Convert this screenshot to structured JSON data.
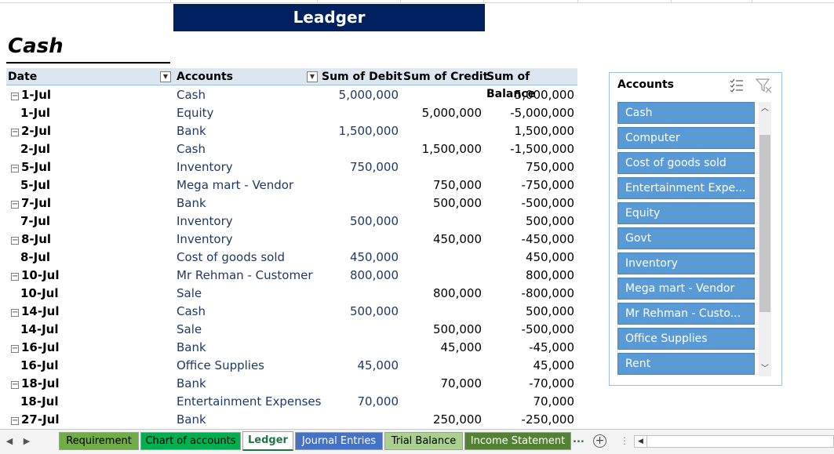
{
  "banner": "Leadger",
  "cash_title": "Cash",
  "pivot": {
    "headers": {
      "date": "Date",
      "accounts": "Accounts",
      "debit": "Sum of Debit",
      "credit": "Sum of Credit",
      "balance": "Sum of Balance"
    },
    "rows": [
      {
        "date": "1-Jul",
        "group": true,
        "account": "Cash",
        "debit": "5,000,000",
        "credit": "",
        "balance": "5,000,000"
      },
      {
        "date": "1-Jul",
        "group": false,
        "account": "Equity",
        "debit": "",
        "credit": "5,000,000",
        "balance": "-5,000,000"
      },
      {
        "date": "2-Jul",
        "group": true,
        "account": "Bank",
        "debit": "1,500,000",
        "credit": "",
        "balance": "1,500,000"
      },
      {
        "date": "2-Jul",
        "group": false,
        "account": "Cash",
        "debit": "",
        "credit": "1,500,000",
        "balance": "-1,500,000"
      },
      {
        "date": "5-Jul",
        "group": true,
        "account": "Inventory",
        "debit": "750,000",
        "credit": "",
        "balance": "750,000"
      },
      {
        "date": "5-Jul",
        "group": false,
        "account": "Mega mart - Vendor",
        "debit": "",
        "credit": "750,000",
        "balance": "-750,000"
      },
      {
        "date": "7-Jul",
        "group": true,
        "account": "Bank",
        "debit": "",
        "credit": "500,000",
        "balance": "-500,000"
      },
      {
        "date": "7-Jul",
        "group": false,
        "account": "Inventory",
        "debit": "500,000",
        "credit": "",
        "balance": "500,000"
      },
      {
        "date": "8-Jul",
        "group": true,
        "account": "Inventory",
        "debit": "",
        "credit": "450,000",
        "balance": "-450,000"
      },
      {
        "date": "8-Jul",
        "group": false,
        "account": "Cost of goods sold",
        "debit": "450,000",
        "credit": "",
        "balance": "450,000"
      },
      {
        "date": "10-Jul",
        "group": true,
        "account": "Mr Rehman - Customer",
        "debit": "800,000",
        "credit": "",
        "balance": "800,000"
      },
      {
        "date": "10-Jul",
        "group": false,
        "account": "Sale",
        "debit": "",
        "credit": "800,000",
        "balance": "-800,000"
      },
      {
        "date": "14-Jul",
        "group": true,
        "account": "Cash",
        "debit": "500,000",
        "credit": "",
        "balance": "500,000"
      },
      {
        "date": "14-Jul",
        "group": false,
        "account": "Sale",
        "debit": "",
        "credit": "500,000",
        "balance": "-500,000"
      },
      {
        "date": "16-Jul",
        "group": true,
        "account": "Bank",
        "debit": "",
        "credit": "45,000",
        "balance": "-45,000"
      },
      {
        "date": "16-Jul",
        "group": false,
        "account": "Office Supplies",
        "debit": "45,000",
        "credit": "",
        "balance": "45,000"
      },
      {
        "date": "18-Jul",
        "group": true,
        "account": "Bank",
        "debit": "",
        "credit": "70,000",
        "balance": "-70,000"
      },
      {
        "date": "18-Jul",
        "group": false,
        "account": "Entertainment Expenses",
        "debit": "70,000",
        "credit": "",
        "balance": "70,000"
      },
      {
        "date": "27-Jul",
        "group": true,
        "account": "Bank",
        "debit": "",
        "credit": "250,000",
        "balance": "-250,000"
      }
    ]
  },
  "slicer": {
    "title": "Accounts",
    "items": [
      "Cash",
      "Computer",
      "Cost of goods sold",
      "Entertainment Expe...",
      "Equity",
      "Govt",
      "Inventory",
      "Mega mart - Vendor",
      "Mr Rehman - Custo...",
      "Office Supplies",
      "Rent"
    ]
  },
  "tabs": [
    {
      "label": "Requirement",
      "color": "#70ad47",
      "active": false
    },
    {
      "label": "Chart of accounts",
      "color": "#00b050",
      "active": false
    },
    {
      "label": "Ledger",
      "color": "#ffffff",
      "active": true
    },
    {
      "label": "Journal Entries",
      "color": "#4472c4",
      "active": false
    },
    {
      "label": "Trial Balance",
      "color": "#a9d08e",
      "active": false
    },
    {
      "label": "Income Statement",
      "color": "#548235",
      "active": false
    }
  ],
  "tabs_more": "...",
  "colors": {
    "banner": "#002060",
    "header_fill": "#dce6f1",
    "slicer_item": "#5b9bd5",
    "active_tab_text": "#217346"
  }
}
